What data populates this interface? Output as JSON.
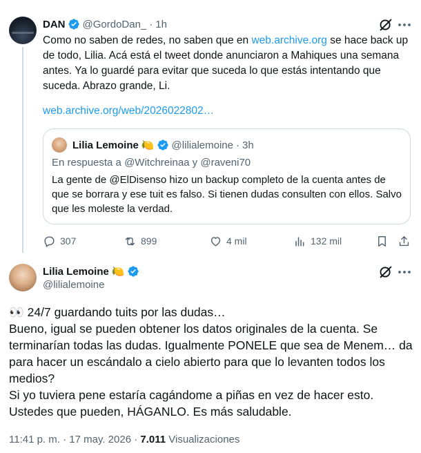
{
  "tweet1": {
    "author_name": "DAN",
    "author_handle": "@GordoDan_",
    "separator": "·",
    "time": "1h",
    "text": "Como no saben de redes, no saben que en ",
    "text_link": "web.archive.org",
    "text_rest": " se hace back up de todo, Lilia. Acá está el tweet donde anunciaron a Mahiques una semana antes. Ya lo guardé para evitar que suceda lo que estás intentando que suceda. Abrazo grande, Li.",
    "url": "web.archive.org/web/2026022802…",
    "quote": {
      "author_name": "Lilia Lemoine",
      "author_emoji": "🍋",
      "author_handle": "@lilialemoine",
      "separator": "·",
      "time": "3h",
      "reply_prefix": "En respuesta a ",
      "reply_user1": "@Witchreinaa",
      "reply_and": " y ",
      "reply_user2": "@raveni70",
      "text": "La gente de @ElDisenso hizo un backup completo de la cuenta antes de que se borrara y ese tuit es falso. Si tienen dudas consulten con ellos. Salvo que les moleste la verdad."
    },
    "actions": {
      "replies": "307",
      "retweets": "899",
      "likes": "4 mil",
      "views": "132 mil"
    }
  },
  "tweet2": {
    "author_name": "Lilia Lemoine",
    "author_emoji": "🍋",
    "author_handle": "@lilialemoine",
    "lines": [
      "👀 24/7 guardando tuits por las dudas…",
      "Bueno, igual se pueden obtener los datos originales de la cuenta. Se terminarían todas las dudas. Igualmente PONELE que sea de Menem… da para hacer un escándalo a cielo abierto para que lo levanten todos los medios?",
      "Si yo tuviera pene estaría cagándome a piñas en vez de hacer esto.",
      "Ustedes que pueden, HÁGANLO. Es más saludable."
    ],
    "timestamp": "11:41 p. m. · 17 may. 2026 · ",
    "views_count": "7.011",
    "views_label": " Visualizaciones"
  },
  "colors": {
    "accent": "#1d9bf0",
    "secondary_text": "#536471",
    "primary_text": "#0f1419",
    "border": "#cfd9de"
  }
}
